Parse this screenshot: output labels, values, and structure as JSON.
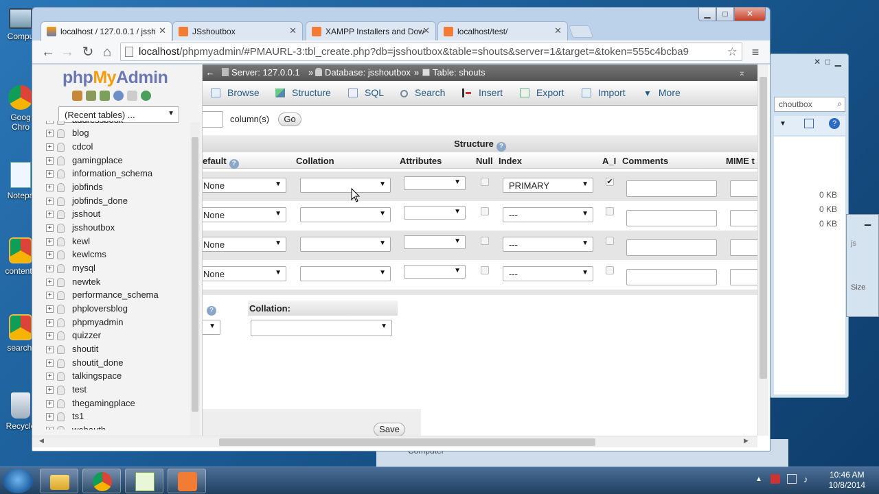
{
  "desktop": {
    "icons": [
      {
        "label": "Compu",
        "icon": "computer-icon"
      },
      {
        "label": "Goog\nChro",
        "icon": "chrome-icon"
      },
      {
        "label": "Notepa",
        "icon": "notepad-icon"
      },
      {
        "label": "contents",
        "icon": "chrome-shortcut-icon"
      },
      {
        "label": "searchf",
        "icon": "chrome-shortcut-icon"
      },
      {
        "label": "Recycle",
        "icon": "recycle-bin-icon"
      }
    ]
  },
  "background_window": {
    "search_text": "choutbox",
    "sizes": [
      "0 KB",
      "0 KB",
      "0 KB"
    ],
    "partial_text": "js",
    "partial_text2": "Size",
    "taskbar_peek": "Computer"
  },
  "browser": {
    "tabs": [
      {
        "label": "localhost / 127.0.0.1 / jssh",
        "icon": "phpmyadmin-favicon",
        "active": true
      },
      {
        "label": "JSshoutbox",
        "icon": "xampp-favicon",
        "active": false
      },
      {
        "label": "XAMPP Installers and Dow",
        "icon": "xampp-favicon",
        "active": false
      },
      {
        "label": "localhost/test/",
        "icon": "xampp-favicon",
        "active": false
      }
    ],
    "url_host": "localhost",
    "url_rest": "/phpmyadmin/#PMAURL-3:tbl_create.php?db=jsshoutbox&table=shouts&server=1&target=&token=555c4bcba9",
    "window_controls": {
      "minimize": "▁",
      "maximize": "□",
      "close": "✕"
    }
  },
  "pma": {
    "logo": {
      "php": "php",
      "my": "My",
      "admin": "Admin"
    },
    "recent_tables": "(Recent tables) ...",
    "databases": [
      "addressbook",
      "blog",
      "cdcol",
      "gamingplace",
      "information_schema",
      "jobfinds",
      "jobfinds_done",
      "jsshout",
      "jsshoutbox",
      "kewl",
      "kewlcms",
      "mysql",
      "newtek",
      "performance_schema",
      "phploversblog",
      "phpmyadmin",
      "quizzer",
      "shoutit",
      "shoutit_done",
      "talkingspace",
      "test",
      "thegamingplace",
      "ts1",
      "webauth"
    ],
    "breadcrumb": {
      "server": "Server: 127.0.0.1",
      "database": "Database: jsshoutbox",
      "table": "Table: shouts",
      "sep": "»",
      "back": "←",
      "collapse": "⌅"
    },
    "tabs": [
      "Browse",
      "Structure",
      "SQL",
      "Search",
      "Insert",
      "Export",
      "Import",
      "More"
    ],
    "add_columns": {
      "label": "column(s)",
      "go": "Go"
    },
    "structure_title": "Structure",
    "headers": {
      "default": "efault",
      "collation": "Collation",
      "attributes": "Attributes",
      "null": "Null",
      "index": "Index",
      "ai": "A_I",
      "comments": "Comments",
      "mime": "MIME t"
    },
    "rows": [
      {
        "default": "None",
        "collation": "",
        "attributes": "",
        "null": false,
        "index": "PRIMARY",
        "ai": true
      },
      {
        "default": "None",
        "collation": "",
        "attributes": "",
        "null": false,
        "index": "---",
        "ai": false
      },
      {
        "default": "None",
        "collation": "",
        "attributes": "",
        "null": false,
        "index": "---",
        "ai": false
      },
      {
        "default": "None",
        "collation": "",
        "attributes": "",
        "null": false,
        "index": "---",
        "ai": false
      }
    ],
    "table_collation_label": "Collation:",
    "save": "Save"
  },
  "taskbar": {
    "time": "10:46 AM",
    "date": "10/8/2014",
    "tray_up": "▲"
  }
}
